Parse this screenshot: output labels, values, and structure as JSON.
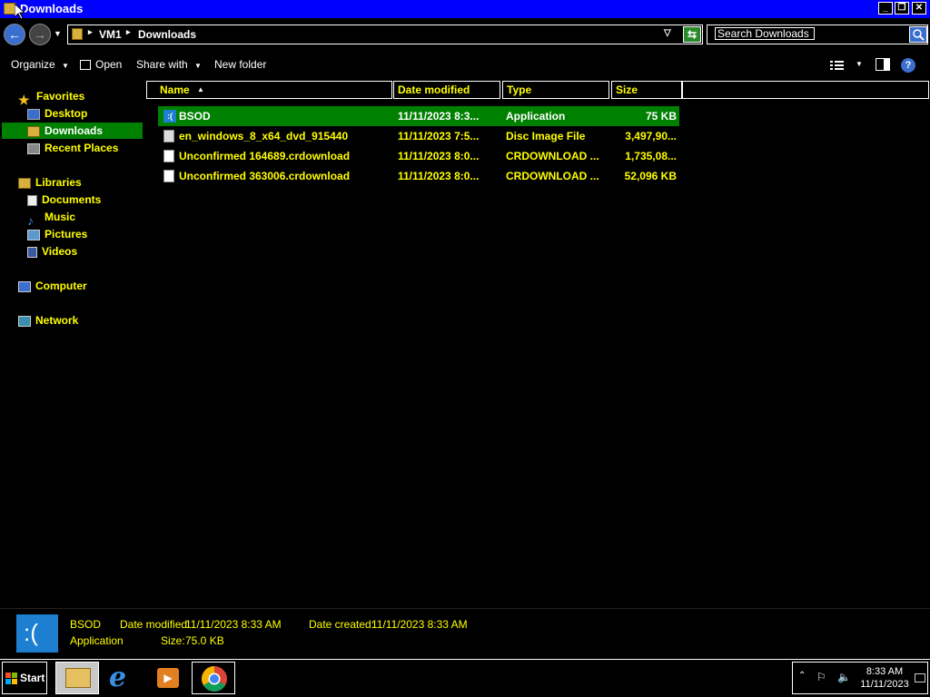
{
  "window": {
    "title": "Downloads"
  },
  "breadcrumb": {
    "items": [
      "VM1",
      "Downloads"
    ]
  },
  "search": {
    "placeholder": "Search Downloads"
  },
  "toolbar": {
    "organize": "Organize",
    "open": "Open",
    "share_with": "Share with",
    "new_folder": "New folder"
  },
  "nav": {
    "favorites": "Favorites",
    "fav_items": [
      "Desktop",
      "Downloads",
      "Recent Places"
    ],
    "libraries": "Libraries",
    "lib_items": [
      "Documents",
      "Music",
      "Pictures",
      "Videos"
    ],
    "computer": "Computer",
    "network": "Network"
  },
  "columns": {
    "name": "Name",
    "date": "Date modified",
    "type": "Type",
    "size": "Size"
  },
  "files": [
    {
      "name": "BSOD",
      "date": "11/11/2023 8:3...",
      "type": "Application",
      "size": "75 KB",
      "icon": "bsod-app-icon"
    },
    {
      "name": "en_windows_8_x64_dvd_915440",
      "date": "11/11/2023 7:5...",
      "type": "Disc Image File",
      "size": "3,497,90...",
      "icon": "disc-image-icon"
    },
    {
      "name": "Unconfirmed 164689.crdownload",
      "date": "11/11/2023 8:0...",
      "type": "CRDOWNLOAD ...",
      "size": "1,735,08...",
      "icon": "file-icon"
    },
    {
      "name": "Unconfirmed 363006.crdownload",
      "date": "11/11/2023 8:0...",
      "type": "CRDOWNLOAD ...",
      "size": "52,096 KB",
      "icon": "file-icon"
    }
  ],
  "details": {
    "name": "BSOD",
    "type": "Application",
    "date_modified_label": "Date modified:",
    "date_modified": "11/11/2023 8:33 AM",
    "date_created_label": "Date created:",
    "date_created": "11/11/2023 8:33 AM",
    "size_label": "Size:",
    "size": "75.0 KB",
    "thumb_text": ":("
  },
  "taskbar": {
    "start": "Start",
    "time": "8:33 AM",
    "date": "11/11/2023"
  },
  "colors": {
    "title_bar": "#0000ff",
    "selection": "#008000",
    "highlight_text": "#ffff00",
    "bsod_blue": "#1e7fd0"
  }
}
